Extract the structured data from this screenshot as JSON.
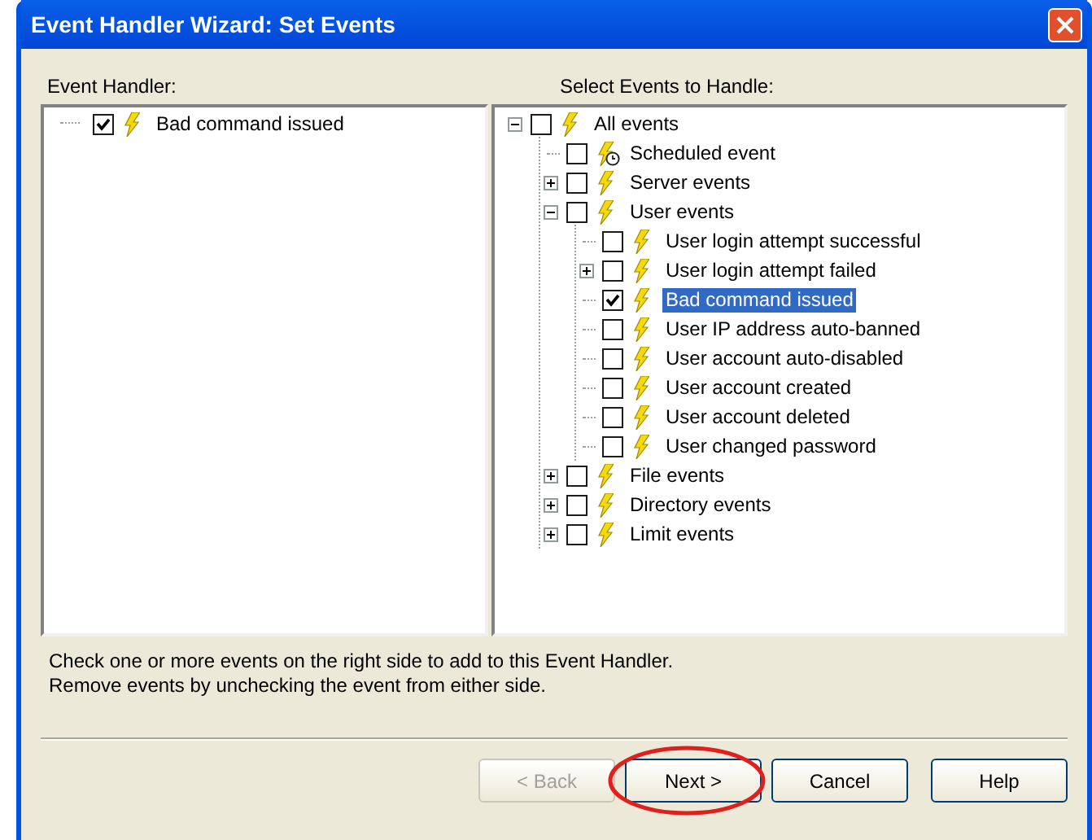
{
  "window": {
    "title": "Event Handler Wizard: Set Events"
  },
  "left_panel": {
    "label": "Event Handler:",
    "tree": [
      {
        "label": "Bad command issued",
        "kind": "event",
        "checked": true,
        "selected": false
      }
    ]
  },
  "right_panel": {
    "label": "Select Events to Handle:",
    "tree": [
      {
        "label": "All events",
        "kind": "event",
        "checked": false,
        "selected": false,
        "expanded": true,
        "children": [
          {
            "label": "Scheduled event",
            "kind": "scheduled",
            "checked": false,
            "selected": false
          },
          {
            "label": "Server events",
            "kind": "event",
            "checked": false,
            "selected": false,
            "expanded": false
          },
          {
            "label": "User events",
            "kind": "event",
            "checked": false,
            "selected": false,
            "expanded": true,
            "children": [
              {
                "label": "User login attempt successful",
                "kind": "event",
                "checked": false,
                "selected": false
              },
              {
                "label": "User login attempt failed",
                "kind": "event",
                "checked": false,
                "selected": false,
                "expanded": false
              },
              {
                "label": "Bad command issued",
                "kind": "event",
                "checked": true,
                "selected": true
              },
              {
                "label": "User IP address auto-banned",
                "kind": "event",
                "checked": false,
                "selected": false
              },
              {
                "label": "User account auto-disabled",
                "kind": "event",
                "checked": false,
                "selected": false
              },
              {
                "label": "User account created",
                "kind": "event",
                "checked": false,
                "selected": false
              },
              {
                "label": "User account deleted",
                "kind": "event",
                "checked": false,
                "selected": false
              },
              {
                "label": "User changed password",
                "kind": "event",
                "checked": false,
                "selected": false
              }
            ]
          },
          {
            "label": "File events",
            "kind": "event",
            "checked": false,
            "selected": false,
            "expanded": false
          },
          {
            "label": "Directory events",
            "kind": "event",
            "checked": false,
            "selected": false,
            "expanded": false
          },
          {
            "label": "Limit events",
            "kind": "event",
            "checked": false,
            "selected": false,
            "expanded": false
          }
        ]
      }
    ]
  },
  "instructions": [
    "Check one or more events on the right side to add to this Event Handler.",
    "Remove events by unchecking the event from either side."
  ],
  "buttons": [
    {
      "label": "< Back",
      "disabled": true,
      "circled": false
    },
    {
      "label": "Next >",
      "disabled": false,
      "circled": true
    },
    {
      "label": "Cancel",
      "disabled": false,
      "circled": false
    },
    {
      "label": "Help",
      "disabled": false,
      "circled": false
    }
  ]
}
